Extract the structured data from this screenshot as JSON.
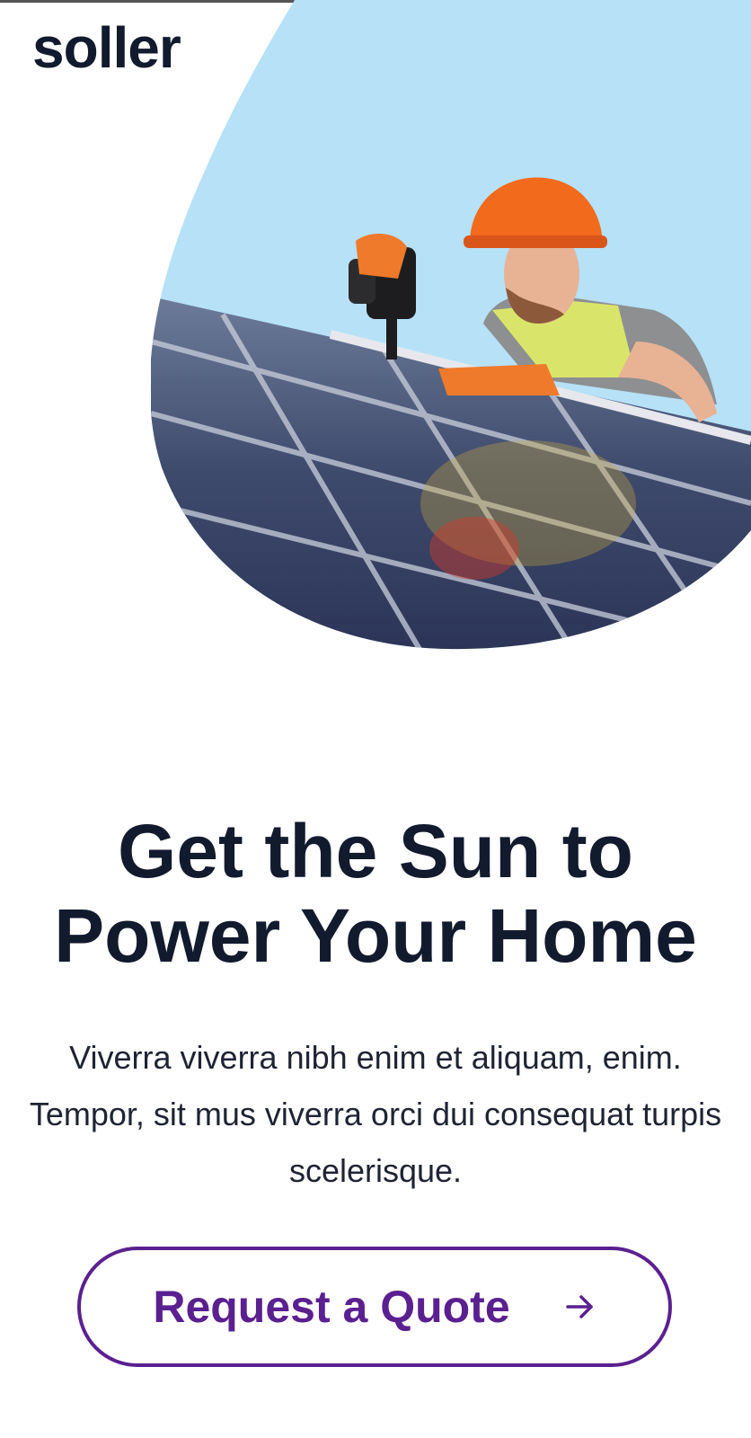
{
  "header": {
    "logo_text": "soller",
    "menu_icon": "hamburger-menu-icon"
  },
  "hero": {
    "image_description_icon": "solar-worker-photo",
    "headline_line1": "Get the Sun to",
    "headline_line2": "Power Your Home",
    "lead": "Viverra viverra nibh enim et aliquam, enim. Tempor, sit mus viverra orci dui consequat turpis scelerisque.",
    "cta_label": "Request a Quote",
    "cta_icon": "arrow-right-icon"
  },
  "colors": {
    "text_dark": "#121a2e",
    "accent_purple": "#5b2090",
    "sky_blue": "#b6e1f7"
  }
}
